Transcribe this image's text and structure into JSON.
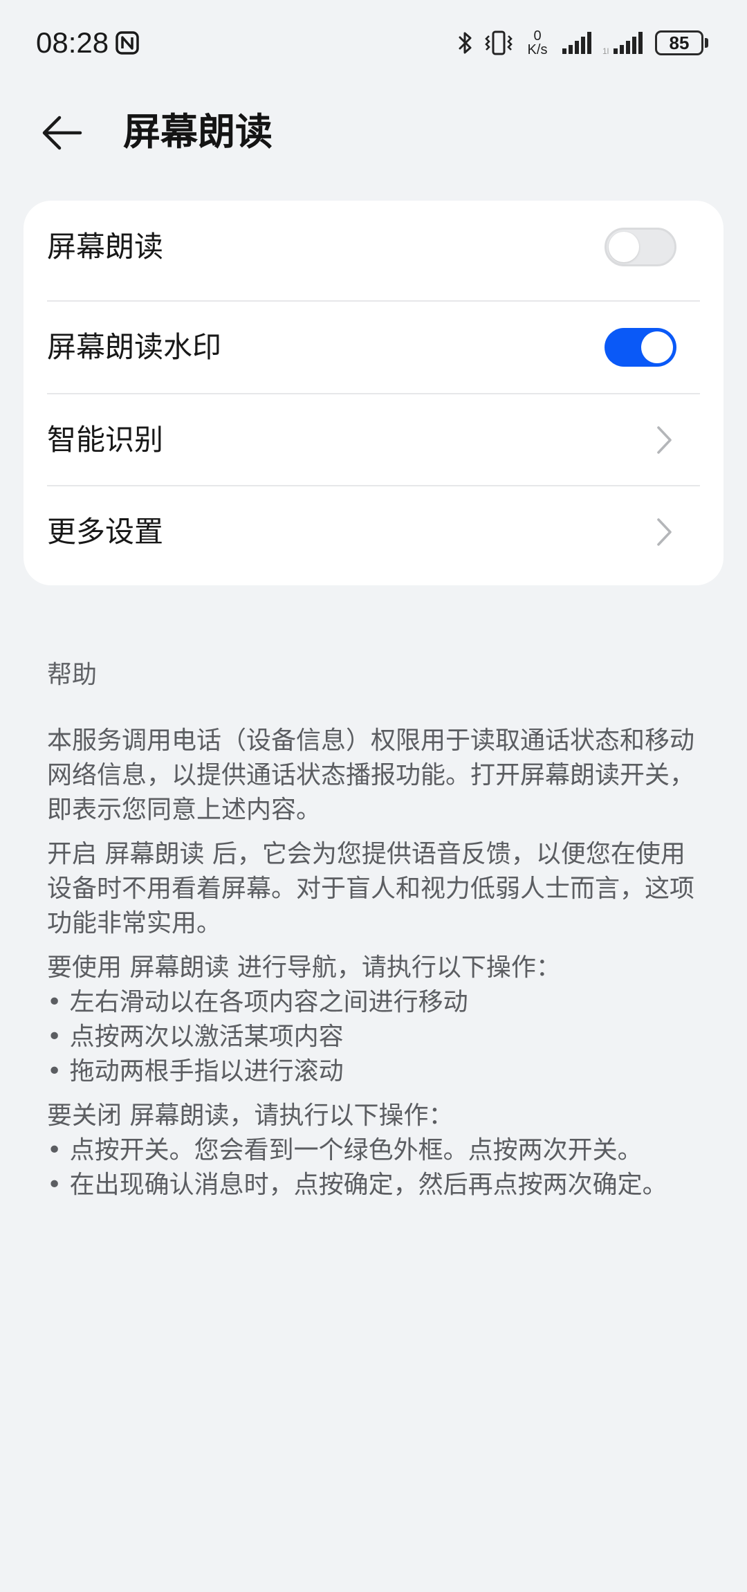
{
  "status_bar": {
    "time": "08:28",
    "net_speed_value": "0",
    "net_speed_unit": "K/s",
    "battery": "85",
    "icons": [
      "nfc-icon",
      "bluetooth-icon",
      "vibrate-icon",
      "signal-icon",
      "signal-icon-2"
    ]
  },
  "header": {
    "title": "屏幕朗读",
    "back_icon": "arrow-left-icon"
  },
  "settings": {
    "items": [
      {
        "label": "屏幕朗读",
        "control": "toggle",
        "state": "off"
      },
      {
        "label": "屏幕朗读水印",
        "control": "toggle",
        "state": "on"
      },
      {
        "label": "智能识别",
        "control": "chevron"
      },
      {
        "label": "更多设置",
        "control": "chevron"
      }
    ]
  },
  "help": {
    "title": "帮助",
    "para1": "本服务调用电话（设备信息）权限用于读取通话状态和移动网络信息，以提供通话状态播报功能。打开屏幕朗读开关，即表示您同意上述内容。",
    "para2": "开启 屏幕朗读 后，它会为您提供语音反馈，以便您在使用设备时不用看着屏幕。对于盲人和视力低弱人士而言，这项功能非常实用。",
    "nav_intro": "要使用 屏幕朗读 进行导航，请执行以下操作：",
    "nav_bullets": [
      "•  左右滑动以在各项内容之间进行移动",
      "•  点按两次以激活某项内容",
      "•  拖动两根手指以进行滚动"
    ],
    "close_intro": "要关闭 屏幕朗读，请执行以下操作：",
    "close_bullets": [
      "•  点按开关。您会看到一个绿色外框。点按两次开关。",
      "•  在出现确认消息时，点按确定，然后再点按两次确定。"
    ]
  },
  "colors": {
    "accent": "#0a59f7",
    "background": "#f1f3f5",
    "card": "#ffffff"
  }
}
